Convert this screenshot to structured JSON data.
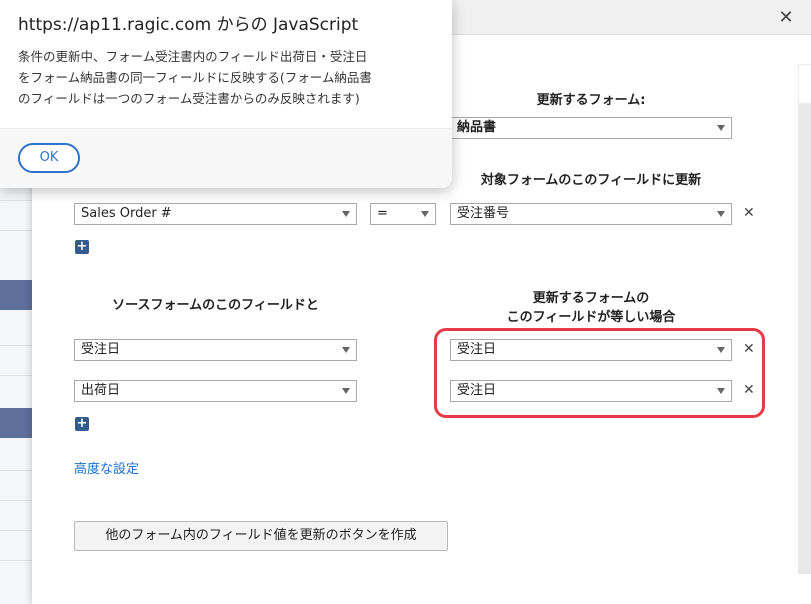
{
  "alert": {
    "title": "https://ap11.ragic.com からの JavaScript",
    "message": "条件の更新中、フォーム受注書内のフィールド出荷日・受注日をフォーム納品書の同一フィールドに反映する(フォーム納品書のフィールドは一つのフォーム受注書からのみ反映されます)",
    "ok_label": "OK"
  },
  "dialog": {
    "close_label": "✕",
    "form_header": "更新するフォーム:",
    "form_select": "納品書",
    "target_field_header": "対象フォームのこのフィールドに更新",
    "link_row": {
      "source": "Sales Order #",
      "operator": "=",
      "target": "受注番号"
    },
    "source_header": "ソースフォームのこのフィールドと",
    "update_header_line1": "更新するフォームの",
    "update_header_line2": "このフィールドが等しい場合",
    "mapping_rows": [
      {
        "source": "受注日",
        "target": "受注日"
      },
      {
        "source": "出荷日",
        "target": "受注日"
      }
    ],
    "remove_label": "✕",
    "add_label": "+",
    "advanced_link": "高度な設定",
    "create_button": "他のフォーム内のフィールド値を更新のボタンを作成"
  },
  "colors": {
    "highlight": "#e53b46",
    "add_button": "#335b8e",
    "link": "#1a73c7",
    "ok_button": "#2f72c9"
  }
}
